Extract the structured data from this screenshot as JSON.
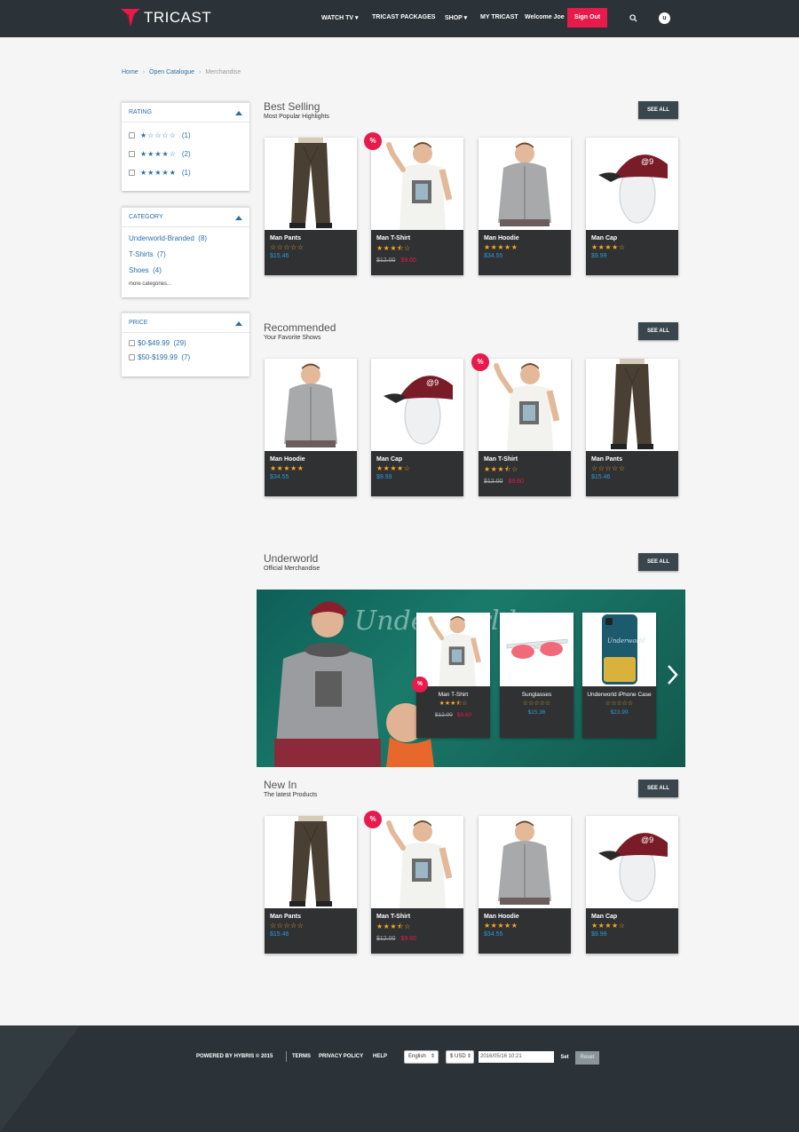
{
  "header": {
    "logo_text": "TRICAST",
    "nav": [
      "WATCH TV",
      "TRICAST PACKAGES",
      "SHOP",
      "MY TRICAST"
    ],
    "welcome": "Welcome Joe",
    "signout": "Sign Out",
    "avatar_initial": "u"
  },
  "breadcrumb": [
    "Home",
    "Open Catalogue",
    "Merchandise"
  ],
  "facets": {
    "rating": {
      "title": "RATING",
      "rows": [
        {
          "stars": "★☆☆☆☆",
          "count": "(1)"
        },
        {
          "stars": "★★★★☆",
          "count": "(2)"
        },
        {
          "stars": "★★★★★",
          "count": "(1)"
        }
      ]
    },
    "category": {
      "title": "CATEGORY",
      "rows": [
        {
          "label": "Underworld-Branded",
          "count": "(8)"
        },
        {
          "label": "T-Shirts",
          "count": "(7)"
        },
        {
          "label": "Shoes",
          "count": "(4)"
        }
      ],
      "more": "more categories..."
    },
    "price": {
      "title": "PRICE",
      "rows": [
        {
          "label": "$0-$49.99",
          "count": "(29)"
        },
        {
          "label": "$50-$199.99",
          "count": "(7)"
        }
      ]
    }
  },
  "see_all": "SEE ALL",
  "sale_badge": "%",
  "sections": {
    "best": {
      "title": "Best Selling",
      "subtitle": "Most Popular Highlights",
      "products": [
        {
          "name": "Man Pants",
          "stars": "☆☆☆☆☆",
          "price": "$15.46"
        },
        {
          "name": "Man T-Shirt",
          "stars": "★★★⯪☆",
          "old": "$12.00",
          "new": "$9.60"
        },
        {
          "name": "Man Hoodie",
          "stars": "★★★★★",
          "price": "$34.55"
        },
        {
          "name": "Man Cap",
          "stars": "★★★★☆",
          "price": "$9.99"
        }
      ]
    },
    "rec": {
      "title": "Recommended",
      "subtitle": "Your Favorite Shows",
      "products": [
        {
          "name": "Man Hoodie",
          "stars": "★★★★★",
          "price": "$34.55"
        },
        {
          "name": "Man Cap",
          "stars": "★★★★☆",
          "price": "$9.99"
        },
        {
          "name": "Man T-Shirt",
          "stars": "★★★⯪☆",
          "old": "$12.00",
          "new": "$9.60"
        },
        {
          "name": "Man Pants",
          "stars": "☆☆☆☆☆",
          "price": "$15.46"
        }
      ]
    },
    "under": {
      "title": "Underworld",
      "subtitle": "Official Merchandise",
      "banner_word": "Underworld",
      "products": [
        {
          "name": "Man T-Shirt",
          "stars": "★★★⯪☆",
          "old": "$12.00",
          "new": "$9.60"
        },
        {
          "name": "Sunglasses",
          "stars": "☆☆☆☆☆",
          "price": "$15.36"
        },
        {
          "name": "Underworld iPhone Case",
          "stars": "☆☆☆☆☆",
          "price": "$23.99"
        }
      ]
    },
    "new": {
      "title": "New In",
      "subtitle": "The latest Products",
      "products": [
        {
          "name": "Man Pants",
          "stars": "☆☆☆☆☆",
          "price": "$15.46"
        },
        {
          "name": "Man T-Shirt",
          "stars": "★★★⯪☆",
          "old": "$12.00",
          "new": "$9.60"
        },
        {
          "name": "Man Hoodie",
          "stars": "★★★★★",
          "price": "$34.55"
        },
        {
          "name": "Man Cap",
          "stars": "★★★★☆",
          "price": "$9.99"
        }
      ]
    }
  },
  "footer": {
    "powered": "POWERED BY HYBRIS © 2015",
    "links": [
      "TERMS",
      "PRIVACY POLICY",
      "HELP"
    ],
    "language": "English",
    "currency": "$ USD",
    "date": "2016/05/16 10:21",
    "set": "Set",
    "reset": "Reset"
  },
  "colors": {
    "header_bg": "#2b3338",
    "accent": "#e8194b",
    "link": "#2a6fa8",
    "star": "#f5a623",
    "price": "#2a9bd8"
  }
}
